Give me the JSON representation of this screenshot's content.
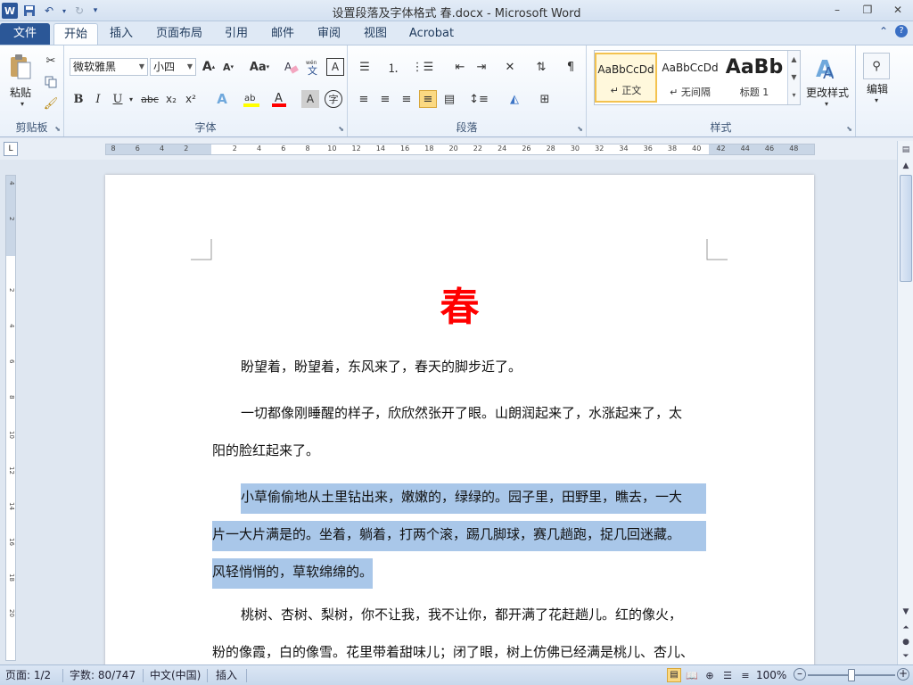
{
  "window": {
    "title": "设置段落及字体格式 春.docx  -  Microsoft Word",
    "app_icon": "W"
  },
  "tabs": [
    "文件",
    "开始",
    "插入",
    "页面布局",
    "引用",
    "邮件",
    "审阅",
    "视图",
    "Acrobat"
  ],
  "ribbon": {
    "clipboard": {
      "paste_label": "粘贴",
      "group_label": "剪贴板"
    },
    "font": {
      "font_name": "微软雅黑",
      "font_size": "小四",
      "group_label": "字体",
      "grow_label": "A",
      "shrink_label": "A",
      "case_label": "Aa",
      "bold": "B",
      "italic": "I",
      "underline": "U",
      "strike": "abc",
      "subscript": "x₂",
      "superscript": "x²",
      "effects": "A",
      "highlight": "ab",
      "font_color": "A",
      "char_shading": "A",
      "enclose": "字",
      "phonetic": "wén",
      "border": "A",
      "clear_format": "A"
    },
    "paragraph": {
      "group_label": "段落"
    },
    "styles": {
      "group_label": "样式",
      "items": [
        {
          "sample": "AaBbCcDd",
          "name": "↵ 正文"
        },
        {
          "sample": "AaBbCcDd",
          "name": "↵ 无间隔"
        },
        {
          "sample": "AaBb",
          "name": "标题 1"
        }
      ],
      "change_styles": "更改样式"
    },
    "editing": {
      "label": "编辑"
    }
  },
  "ruler": {
    "ticks": [
      "8",
      "6",
      "4",
      "2",
      "",
      "2",
      "4",
      "6",
      "8",
      "10",
      "12",
      "14",
      "16",
      "18",
      "20",
      "22",
      "24",
      "26",
      "28",
      "30",
      "32",
      "34",
      "36",
      "38",
      "40",
      "42",
      "44",
      "46",
      "48"
    ]
  },
  "vruler": {
    "ticks": [
      "4",
      "2",
      "",
      "2",
      "4",
      "6",
      "8",
      "10",
      "12",
      "14",
      "16",
      "18",
      "20"
    ]
  },
  "document": {
    "title": "春",
    "paragraphs": [
      {
        "lines": [
          "盼望着，盼望着，东风来了，春天的脚步近了。"
        ]
      },
      {
        "lines": [
          "一切都像刚睡醒的样子，欣欣然张开了眼。山朗润起来了，水涨起来了，太",
          "阳的脸红起来了。"
        ]
      },
      {
        "lines": [
          "小草偷偷地从土里钻出来，嫩嫩的，绿绿的。园子里，田野里，瞧去，一大",
          "片一大片满是的。坐着，躺着，打两个滚，踢几脚球，赛几趟跑，捉几回迷藏。",
          "风轻悄悄的，草软绵绵的。"
        ]
      },
      {
        "lines": [
          "桃树、杏树、梨树，你不让我，我不让你，都开满了花赶趟儿。红的像火，",
          "粉的像霞，白的像雪。花里带着甜味儿；闭了眼，树上仿佛已经满是桃儿、杏儿、"
        ]
      }
    ]
  },
  "statusbar": {
    "page": "页面: 1/2",
    "words": "字数: 80/747",
    "language": "中文(中国)",
    "mode": "插入",
    "zoom": "100%",
    "zoom_level_fraction": 0.5
  },
  "colors": {
    "title_red": "#ff0000",
    "selection": "#a9c7e9",
    "file_tab": "#2b5797"
  }
}
